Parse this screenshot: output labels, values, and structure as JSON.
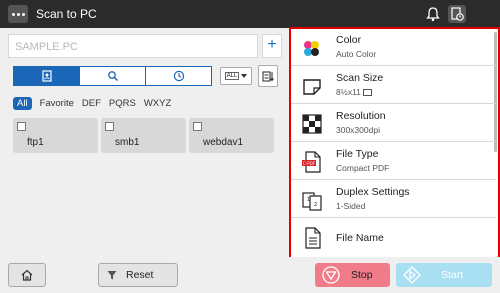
{
  "header": {
    "title": "Scan to PC",
    "icons": [
      "menu-icon",
      "bell-icon",
      "device-status-icon"
    ]
  },
  "address": {
    "value": "SAMPLE.PC",
    "add_label": "+"
  },
  "tabs": [
    {
      "icon": "address-book-icon",
      "active": true
    },
    {
      "icon": "search-icon",
      "active": false
    },
    {
      "icon": "clock-icon",
      "active": false
    }
  ],
  "list_filter": {
    "label": "ALL"
  },
  "filters": [
    "All",
    "Favorite",
    "DEF",
    "PQRS",
    "WXYZ"
  ],
  "destinations": [
    {
      "name": "ftp1"
    },
    {
      "name": "smb1"
    },
    {
      "name": "webdav1"
    }
  ],
  "settings": [
    {
      "title": "Color",
      "value": "Auto Color",
      "icon": "color-icon"
    },
    {
      "title": "Scan Size",
      "value": "8½x11",
      "icon": "scan-size-icon"
    },
    {
      "title": "Resolution",
      "value": "300x300dpi",
      "icon": "resolution-icon"
    },
    {
      "title": "File Type",
      "value": "Compact PDF",
      "icon": "pdf-file-icon",
      "badge": "C-PDF"
    },
    {
      "title": "Duplex Settings",
      "value": "1-Sided",
      "icon": "duplex-icon"
    },
    {
      "title": "File Name",
      "value": "",
      "icon": "file-name-icon"
    }
  ],
  "footer": {
    "reset_label": "Reset",
    "stop_label": "Stop",
    "start_label": "Start"
  },
  "colors": {
    "accent": "#1c66b8",
    "highlight": "#e00000",
    "stop": "#f07c8a",
    "start": "#a9dff2"
  }
}
